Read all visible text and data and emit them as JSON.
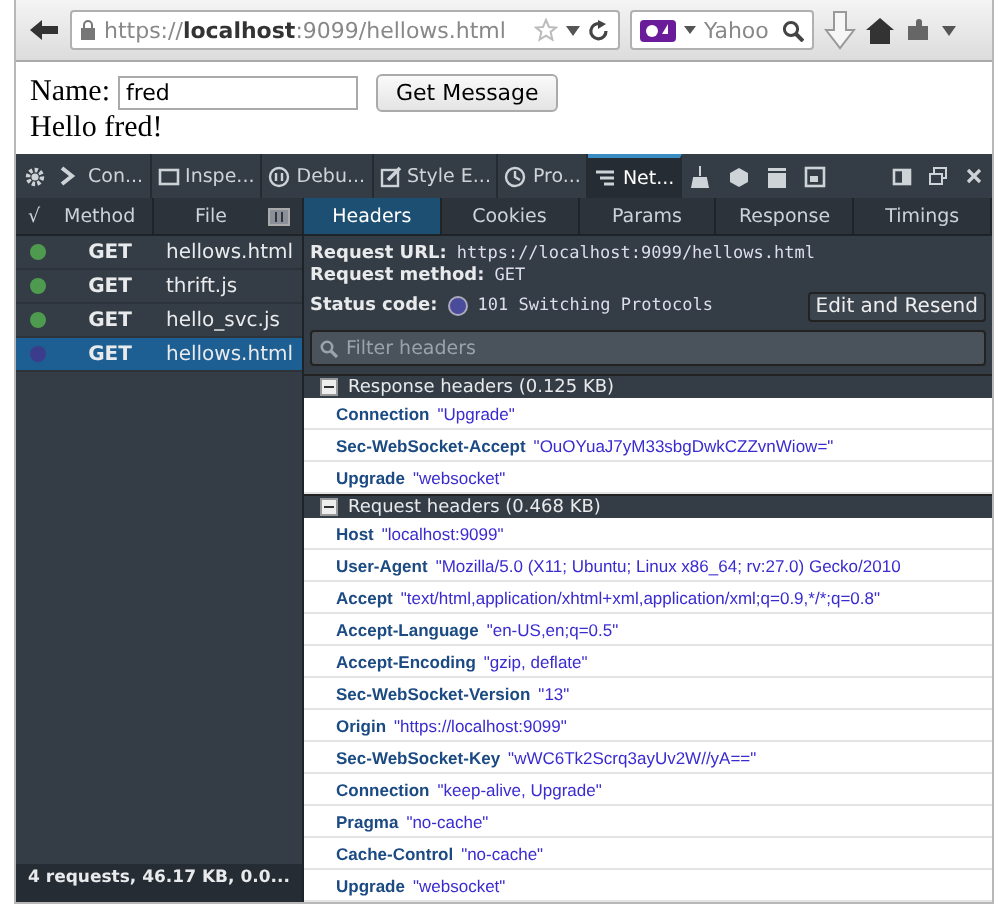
{
  "browser": {
    "url": "https://**localhost**:9099/hellows.html",
    "search_placeholder": "Yahoo"
  },
  "page": {
    "name_label": "Name:",
    "name_value": "fred",
    "button": "Get Message",
    "output": "Hello fred!"
  },
  "devtools": {
    "tools": [
      {
        "kind": "console",
        "label": "Con...",
        "selected": false
      },
      {
        "kind": "inspector",
        "label": "Inspe...",
        "selected": false
      },
      {
        "kind": "debugger",
        "label": "Debu...",
        "selected": false
      },
      {
        "kind": "style",
        "label": "Style E...",
        "selected": false
      },
      {
        "kind": "profiler",
        "label": "Pro...",
        "selected": false
      },
      {
        "kind": "network",
        "label": "Net...",
        "selected": true
      }
    ]
  },
  "requests": {
    "check_column": "√",
    "columns": [
      "Method",
      "File"
    ],
    "rows": [
      {
        "method": "GET",
        "file": "hellows.html",
        "color": "#4e9a4e",
        "selected": false
      },
      {
        "method": "GET",
        "file": "thrift.js",
        "color": "#4e9a4e",
        "selected": false
      },
      {
        "method": "GET",
        "file": "hello_svc.js",
        "color": "#4e9a4e",
        "selected": false
      },
      {
        "method": "GET",
        "file": "hellows.html",
        "color": "#3c3c8c",
        "selected": true
      }
    ],
    "summary": "4 requests, 46.17 KB, 0.0..."
  },
  "details": {
    "tabs": [
      {
        "label": "Headers",
        "selected": true
      },
      {
        "label": "Cookies",
        "selected": false
      },
      {
        "label": "Params",
        "selected": false
      },
      {
        "label": "Response",
        "selected": false
      },
      {
        "label": "Timings",
        "selected": false
      }
    ],
    "fields": [
      {
        "label": "Request URL:",
        "value": "https://localhost:9099/hellows.html"
      },
      {
        "label": "Request method:",
        "value": "GET"
      },
      {
        "label": "Status code:",
        "value": "101 Switching Protocols"
      }
    ],
    "resend_button": "Edit and Resend",
    "filter_placeholder": "Filter headers",
    "sections": [
      {
        "title": "Response headers (0.125 KB)",
        "expanded": true,
        "headers": [
          {
            "name": "Connection",
            "value": "\"Upgrade\""
          },
          {
            "name": "Sec-WebSocket-Accept",
            "value": "\"OuOYuaJ7yM33sbgDwkCZZvnWiow=\""
          },
          {
            "name": "Upgrade",
            "value": "\"websocket\""
          }
        ]
      },
      {
        "title": "Request headers (0.468 KB)",
        "expanded": true,
        "headers": [
          {
            "name": "Host",
            "value": "\"localhost:9099\""
          },
          {
            "name": "User-Agent",
            "value": "\"Mozilla/5.0 (X11; Ubuntu; Linux x86_64; rv:27.0) Gecko/2010"
          },
          {
            "name": "Accept",
            "value": "\"text/html,application/xhtml+xml,application/xml;q=0.9,*/*;q=0.8\""
          },
          {
            "name": "Accept-Language",
            "value": "\"en-US,en;q=0.5\""
          },
          {
            "name": "Accept-Encoding",
            "value": "\"gzip, deflate\""
          },
          {
            "name": "Sec-WebSocket-Version",
            "value": "\"13\""
          },
          {
            "name": "Origin",
            "value": "\"https://localhost:9099\""
          },
          {
            "name": "Sec-WebSocket-Key",
            "value": "\"wWC6Tk2Scrq3ayUv2W//yA==\""
          },
          {
            "name": "Connection",
            "value": "\"keep-alive, Upgrade\""
          },
          {
            "name": "Pragma",
            "value": "\"no-cache\""
          },
          {
            "name": "Cache-Control",
            "value": "\"no-cache\""
          },
          {
            "name": "Upgrade",
            "value": "\"websocket\""
          }
        ]
      }
    ]
  }
}
